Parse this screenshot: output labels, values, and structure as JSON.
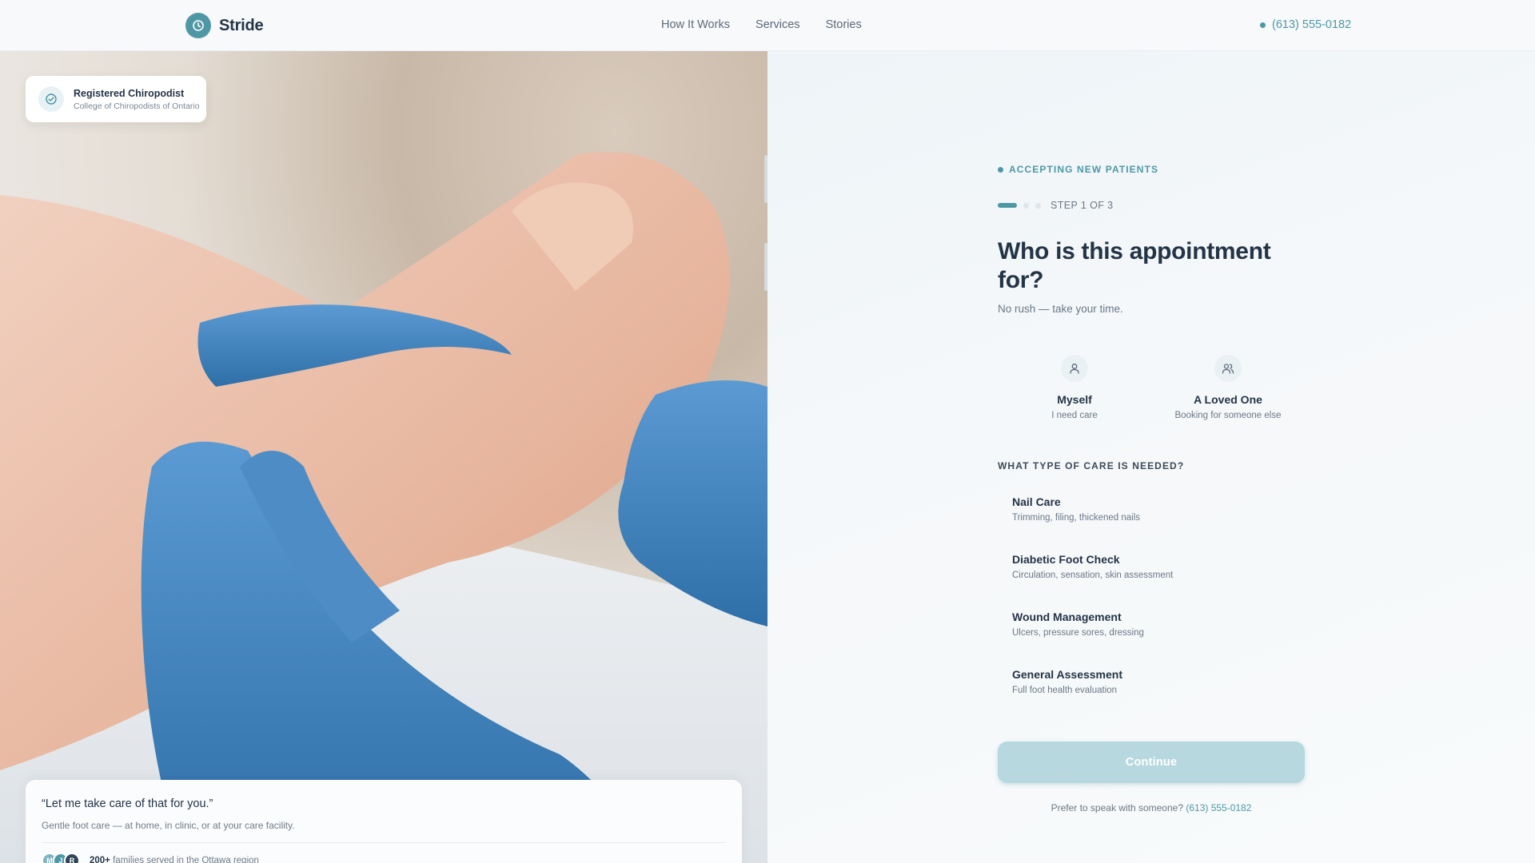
{
  "header": {
    "brand": "Stride",
    "nav": [
      "How It Works",
      "Services",
      "Stories"
    ],
    "phone": "(613) 555-0182"
  },
  "credential": {
    "title": "Registered Chiropodist",
    "subtitle": "College of Chiropodists of Ontario"
  },
  "testimonial": {
    "quote": "“Let me take care of that for you.”",
    "subtitle": "Gentle foot care — at home, in clinic, or at your care facility.",
    "avatars": [
      "M",
      "J",
      "R"
    ],
    "count": "200+",
    "count_text": "families served in the Ottawa region"
  },
  "form": {
    "status": "ACCEPTING NEW PATIENTS",
    "step_label": "STEP 1 OF 3",
    "heading": "Who is this appointment for?",
    "subheading": "No rush — take your time.",
    "who_options": [
      {
        "title": "Myself",
        "subtitle": "I need care",
        "icon": "user-icon"
      },
      {
        "title": "A Loved One",
        "subtitle": "Booking for someone else",
        "icon": "users-icon"
      }
    ],
    "care_label": "WHAT TYPE OF CARE IS NEEDED?",
    "care_options": [
      {
        "title": "Nail Care",
        "subtitle": "Trimming, filing, thickened nails"
      },
      {
        "title": "Diabetic Foot Check",
        "subtitle": "Circulation, sensation, skin assessment"
      },
      {
        "title": "Wound Management",
        "subtitle": "Ulcers, pressure sores, dressing"
      },
      {
        "title": "General Assessment",
        "subtitle": "Full foot health evaluation"
      }
    ],
    "continue_label": "Continue",
    "prefer_text": "Prefer to speak with someone?",
    "prefer_phone": "(613) 555-0182"
  },
  "colors": {
    "accent": "#4e98a6",
    "heading": "#243447",
    "continue_disabled": "#b7d8df",
    "glove": "#3f86c4"
  }
}
